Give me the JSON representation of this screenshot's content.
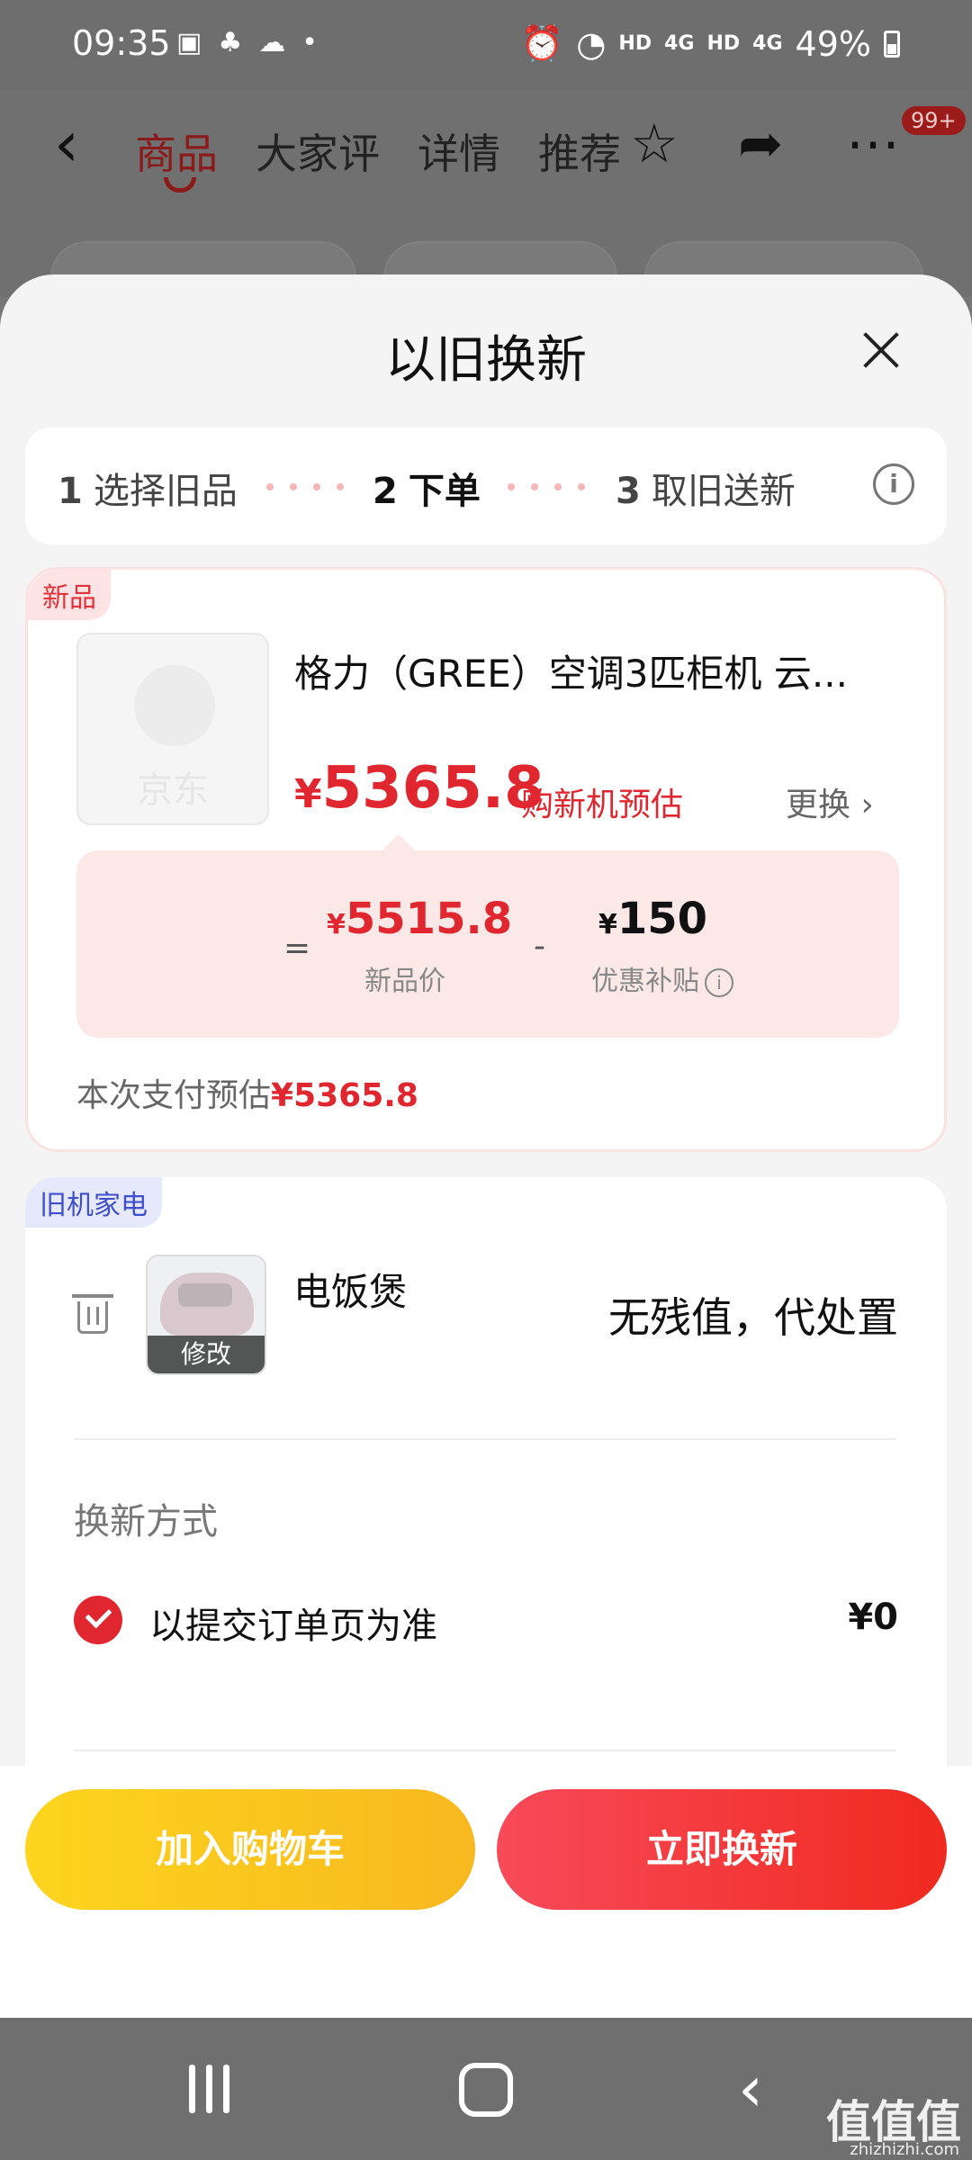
{
  "status": {
    "time": "09:35",
    "left_icons": [
      "gallery-icon",
      "app-icon",
      "wechat-icon",
      "dot-icon"
    ],
    "hd1": "HD",
    "net1": "4G",
    "hd2": "HD",
    "net2": "4G",
    "battery": "49%"
  },
  "header": {
    "tabs": [
      "商品",
      "大家评",
      "详情",
      "推荐"
    ],
    "active_tab": "商品",
    "badge": "99+"
  },
  "sheet": {
    "title": "以旧换新",
    "steps": [
      {
        "num": "1",
        "label": "选择旧品"
      },
      {
        "num": "2",
        "label": "下单"
      },
      {
        "num": "3",
        "label": "取旧送新"
      }
    ],
    "active_step": "2"
  },
  "new_product": {
    "tag": "新品",
    "thumb_text": "京东",
    "name": "格力（GREE）空调3匹柜机 云...",
    "price_symbol": "¥",
    "price": "5365.8",
    "price_note": "购新机预估",
    "change_label": "更换",
    "breakdown": {
      "equals": "=",
      "original_symbol": "¥",
      "original": "5515.8",
      "original_label": "新品价",
      "minus": "-",
      "subsidy_symbol": "¥",
      "subsidy": "150",
      "subsidy_label": "优惠补贴"
    },
    "pay_label": "本次支付预估",
    "pay_value": "¥5365.8"
  },
  "old_appliance": {
    "tag": "旧机家电",
    "name": "电饭煲",
    "edit_label": "修改",
    "value_text": "无残值，代处置",
    "method_label": "换新方式",
    "method_option": "以提交订单页为准",
    "method_price": "¥0"
  },
  "actions": {
    "cart": "加入购物车",
    "trade": "立即换新"
  },
  "watermark": {
    "main": "值值值",
    "sub": "zhizhizhi.com"
  },
  "colors": {
    "accent": "#e0262f",
    "cart_yellow": "#fcd51e",
    "trade_red": "#f02a1f",
    "old_tag_blue": "#3f4fcc"
  }
}
